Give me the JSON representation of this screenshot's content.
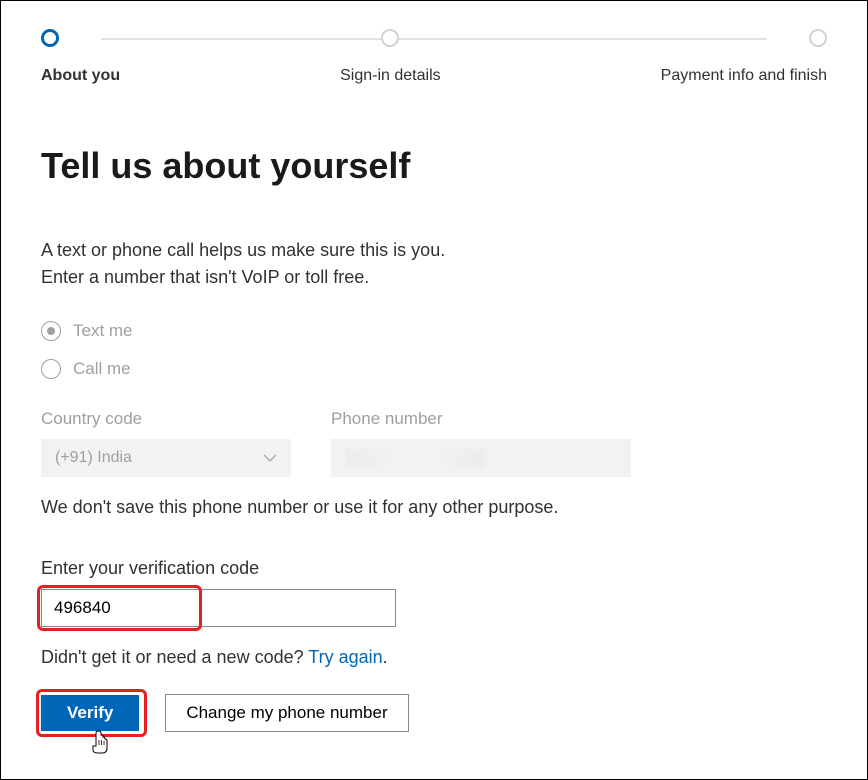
{
  "stepper": {
    "steps": [
      {
        "label": "About you",
        "active": true
      },
      {
        "label": "Sign-in details",
        "active": false
      },
      {
        "label": "Payment info and finish",
        "active": false
      }
    ]
  },
  "heading": "Tell us about yourself",
  "instructions_line1": "A text or phone call helps us make sure this is you.",
  "instructions_line2": "Enter a number that isn't VoIP or toll free.",
  "radio_options": {
    "text_me": "Text me",
    "call_me": "Call me"
  },
  "fields": {
    "country_code_label": "Country code",
    "country_code_value": "(+91) India",
    "phone_label": "Phone number",
    "phone_value": ""
  },
  "privacy_note": "We don't save this phone number or use it for any other purpose.",
  "verify": {
    "label": "Enter your verification code",
    "value": "496840"
  },
  "resend": {
    "text": "Didn't get it or need a new code? ",
    "link": "Try again",
    "suffix": "."
  },
  "buttons": {
    "verify": "Verify",
    "change": "Change my phone number"
  }
}
